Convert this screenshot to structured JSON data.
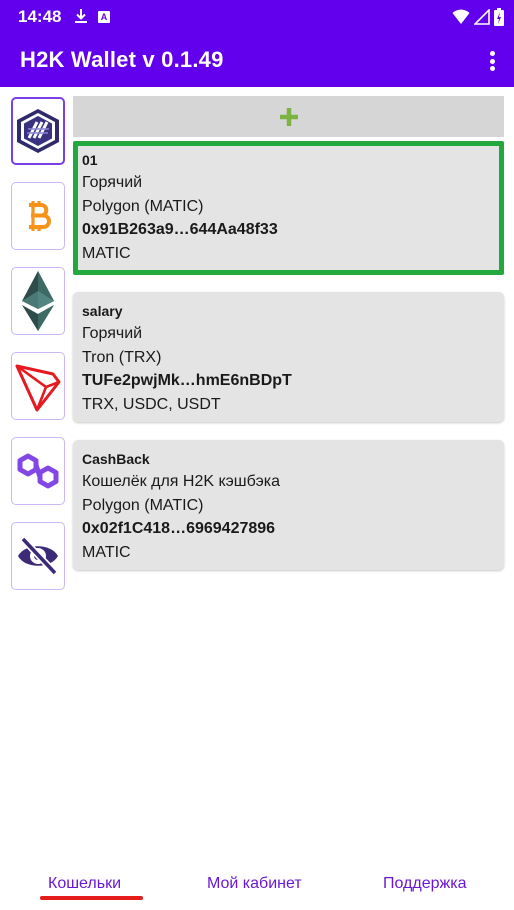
{
  "status_bar": {
    "time": "14:48",
    "download_icon": "download-icon",
    "notification_badge": "A",
    "wifi_icon": "wifi-icon",
    "signal_icon": "signal-icon",
    "battery_icon": "battery-icon"
  },
  "app_bar": {
    "title": "H2K Wallet v 0.1.49",
    "menu_icon": "more-vert-icon"
  },
  "sidebar": {
    "items": [
      {
        "name": "h2k-logo-icon",
        "selected": true
      },
      {
        "name": "bitcoin-icon",
        "selected": false
      },
      {
        "name": "ethereum-icon",
        "selected": false
      },
      {
        "name": "tron-icon",
        "selected": false
      },
      {
        "name": "polygon-icon",
        "selected": false
      },
      {
        "name": "eye-off-icon",
        "selected": false
      }
    ]
  },
  "add_button": {
    "icon": "plus-icon",
    "label": "+"
  },
  "wallets": [
    {
      "name": "01",
      "type": "Горячий",
      "network": "Polygon (MATIC)",
      "address": "0x91B263a9…644Aa48f33",
      "tokens": "MATIC",
      "selected": true
    },
    {
      "name": "salary",
      "type": "Горячий",
      "network": "Tron (TRX)",
      "address": "TUFe2pwjMk…hmE6nBDpT",
      "tokens": "TRX, USDC, USDT",
      "selected": false
    },
    {
      "name": "CashBack",
      "type": "Кошелёк для H2K кэшбэка",
      "network": "Polygon (MATIC)",
      "address": "0x02f1C418…6969427896",
      "tokens": "MATIC",
      "selected": false
    }
  ],
  "bottom_nav": {
    "items": [
      {
        "label": "Кошельки",
        "active": true
      },
      {
        "label": "Мой кабинет",
        "active": false
      },
      {
        "label": "Поддержка",
        "active": false
      }
    ]
  },
  "colors": {
    "primary": "#6200ee",
    "selected_border": "#23a83f",
    "plus": "#7cb342",
    "nav_text": "#6b18d6",
    "nav_indicator": "#e51c1c",
    "bitcoin": "#f7931a",
    "tron": "#e5191f",
    "polygon": "#8247e5"
  }
}
